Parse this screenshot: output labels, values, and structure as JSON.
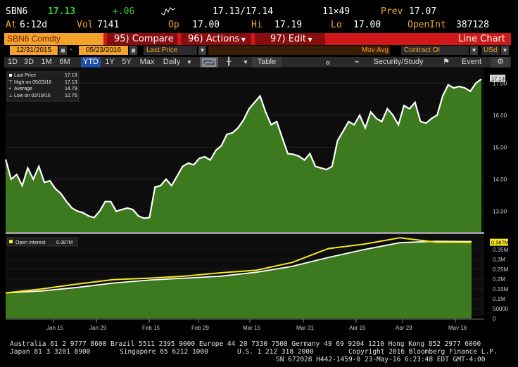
{
  "quote": {
    "ticker": "SBN6",
    "last": "17.13",
    "change": "+.06",
    "bid_ask": "17.13/17.14",
    "size": "11×49",
    "prev_label": "Prev",
    "prev": "17.07",
    "at_label": "At",
    "time": "6:12d",
    "vol_label": "Vol",
    "vol": "7141",
    "op_label": "Op",
    "open": "17.00",
    "hi_label": "Hi",
    "high": "17.19",
    "lo_label": "Lo",
    "low": "17.00",
    "oi_label": "OpenInt",
    "open_int": "387128"
  },
  "toolbar": {
    "security": "SBN6 Comdty",
    "compare": "95) Compare",
    "actions": "96) Actions",
    "edit": "97) Edit",
    "view": "Line Chart"
  },
  "settings": {
    "start_date": "12/31/2015",
    "dash": "-",
    "end_date": "05/23/2016",
    "field": "Last Price",
    "mov_avg": "Mov Avg",
    "contract": "Contract OI",
    "currency": "USd"
  },
  "ranges": [
    "1D",
    "3D",
    "1M",
    "6M",
    "YTD",
    "1Y",
    "5Y",
    "Max"
  ],
  "selected_range": "YTD",
  "period": "Daily",
  "tools": {
    "table": "Table",
    "back": "«",
    "security_study": "Security/Study",
    "event": "Event"
  },
  "colors": {
    "amber": "#f0a430",
    "toolbar_red": "#d01818",
    "selected_blue": "#1f4fa8",
    "area_green": "#3d7a1f",
    "oi_yellow": "#f7e81e"
  },
  "chart_data": [
    {
      "type": "area",
      "legend": [
        {
          "label": "Last Price",
          "value": "17.13"
        },
        {
          "label": "High on 05/23/16",
          "value": "17.13"
        },
        {
          "label": "Average",
          "value": "14.79"
        },
        {
          "label": "Low on 02/19/16",
          "value": "12.75"
        }
      ],
      "last_label": "17.13",
      "ytick_labels": [
        "17.00",
        "16.00",
        "15.00",
        "14.00",
        "13.00"
      ],
      "yticks": [
        17,
        16,
        15,
        14,
        13
      ],
      "ylim": [
        12.35,
        17.38
      ],
      "values": [
        14.62,
        14.0,
        14.15,
        13.8,
        14.35,
        14.0,
        14.4,
        13.9,
        13.95,
        13.7,
        13.55,
        13.3,
        13.1,
        13.0,
        12.95,
        12.85,
        12.8,
        13.0,
        13.3,
        13.3,
        13.0,
        13.05,
        13.1,
        13.05,
        12.85,
        12.78,
        12.8,
        13.75,
        13.8,
        14.0,
        13.8,
        14.1,
        14.4,
        14.5,
        14.45,
        14.65,
        14.7,
        14.6,
        14.9,
        15.05,
        15.4,
        15.45,
        15.6,
        15.85,
        16.2,
        16.4,
        16.6,
        16.1,
        15.7,
        15.8,
        15.3,
        14.8,
        14.78,
        14.72,
        14.6,
        14.8,
        14.4,
        14.35,
        14.3,
        14.4,
        15.2,
        15.5,
        15.8,
        15.7,
        16.0,
        15.6,
        16.1,
        15.9,
        15.8,
        16.2,
        16.0,
        15.7,
        16.3,
        16.2,
        16.4,
        15.8,
        15.75,
        15.9,
        16.0,
        16.6,
        16.95,
        16.85,
        16.9,
        16.85,
        16.75,
        17.0,
        17.13
      ]
    },
    {
      "type": "line",
      "legend": [
        {
          "label": "Open Interest",
          "value": "0.387M"
        }
      ],
      "last_label": "0.387M",
      "ytick_labels": [
        "0.35M",
        "0.3M",
        "0.25M",
        "0.2M",
        "0.15M",
        "0.1M",
        "50000",
        "0"
      ],
      "yticks": [
        350000,
        300000,
        250000,
        200000,
        150000,
        100000,
        50000,
        0
      ],
      "ylim": [
        0,
        400000
      ],
      "series": [
        {
          "name": "Open Interest",
          "values": [
            130000,
            150000,
            175000,
            197000,
            205000,
            215000,
            232000,
            245000,
            285000,
            355000,
            378000,
            410000,
            388000,
            387128
          ]
        }
      ],
      "secondary_values": [
        130000,
        140000,
        158000,
        180000,
        195000,
        205000,
        215000,
        235000,
        265000,
        310000,
        350000,
        385000,
        392000,
        391000
      ]
    }
  ],
  "x_axis": {
    "ticks": [
      "Jan 15",
      "Jan 29",
      "Feb 15",
      "Feb 29",
      "Mar 15",
      "Mar 31",
      "Apr 15",
      "Apr 29",
      "May 16"
    ],
    "year": "2016"
  },
  "footer": {
    "line1": "Australia 61 2 9777 8600 Brazil 5511 2395 9000 Europe 44 20 7330 7500 Germany 49 69 9204 1210 Hong Kong 852 2977 6000",
    "line2a": "Japan 81 3 3201 8900",
    "line2b": "Singapore 65 6212 1000",
    "line2c": "U.S. 1 212 318 2000",
    "line2d": "Copyright 2016 Bloomberg Finance L.P.",
    "line3": "SN 672028 H442-1459-0 23-May-16  6:23:48 EDT  GMT-4:00"
  }
}
